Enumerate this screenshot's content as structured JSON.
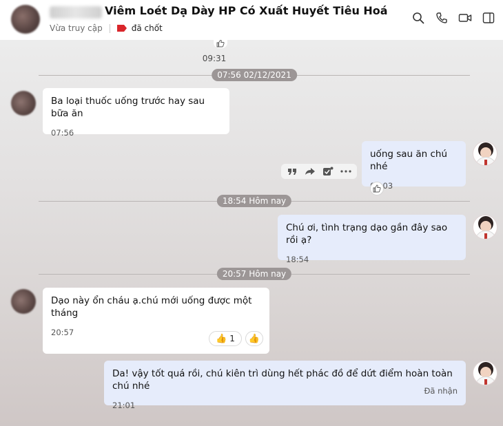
{
  "header": {
    "title": "Viêm Loét Dạ Dày HP Có Xuất Huyết Tiêu Hoá",
    "status": "Vừa truy cập",
    "tag": {
      "label": "đã chốt",
      "color": "#d9262b",
      "icon": "tag-icon"
    },
    "actions": [
      "search-icon",
      "phone-icon",
      "video-icon",
      "sidebar-toggle-icon"
    ]
  },
  "chat": {
    "top_time": "09:31",
    "dividers": {
      "d1": "07:56 02/12/2021",
      "d2": "18:54 Hôm nay",
      "d3": "20:57 Hôm nay"
    },
    "messages": {
      "m1": {
        "text": "Ba loại thuốc uống trước hay sau bữa ăn",
        "time": "07:56",
        "direction": "in"
      },
      "m2": {
        "text": "uống sau ăn chú nhé",
        "time": "08:03",
        "direction": "out"
      },
      "m3": {
        "text": "Chú ơi, tình trạng dạo gần đây sao rồi ạ?",
        "time": "18:54",
        "direction": "out"
      },
      "m4": {
        "text": "Dạo này ổn cháu ạ.chú mới uống được một tháng",
        "time": "20:57",
        "direction": "in",
        "reaction": {
          "emoji": "👍",
          "count": "1"
        }
      },
      "m5": {
        "text": "Da! vậy tốt quá rồi, chú kiên trì dùng hết phác đồ để dứt điểm hoàn toàn chú nhé",
        "time": "21:01",
        "direction": "out",
        "status": "Đã nhận"
      }
    },
    "hover_actions": [
      "quote-icon",
      "forward-icon",
      "task-icon",
      "more-icon"
    ],
    "colors": {
      "incoming": "#ffffff",
      "outgoing": "#e6ecfb",
      "divider_pill": "#9c9696"
    }
  }
}
